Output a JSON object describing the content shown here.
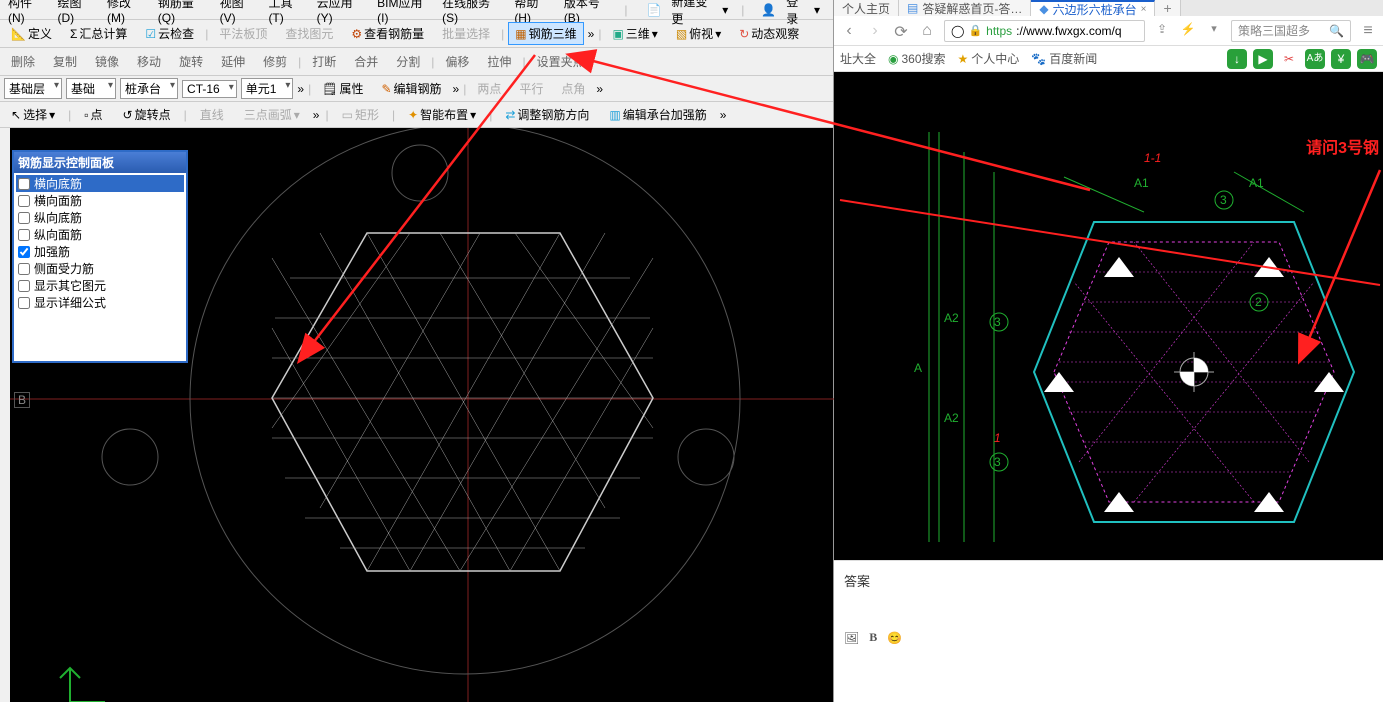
{
  "menubar": {
    "items": [
      "构件(N)",
      "绘图(D)",
      "修改(M)",
      "钢筋量(Q)",
      "视图(V)",
      "工具(T)",
      "云应用(Y)",
      "BIM应用(I)",
      "在线服务(S)",
      "帮助(H)",
      "版本号(B)"
    ],
    "new_change": "新建变更",
    "login": "登录"
  },
  "toolbar1": {
    "define": "定义",
    "sum_calc": "汇总计算",
    "cloud_check": "云检查",
    "flat_top": "平法板顶",
    "find_tu": "查找图元",
    "view_rebar_qty": "查看钢筋量",
    "batch_sel": "批量选择",
    "rebar_3d": "钢筋三维",
    "three_d": "三维",
    "top_view": "俯视",
    "dynamic_obs": "动态观察"
  },
  "toolbar2": {
    "del": "删除",
    "copy": "复制",
    "mirror": "镜像",
    "move": "移动",
    "rotate": "旋转",
    "extend": "延伸",
    "trim": "修剪",
    "break": "打断",
    "merge": "合并",
    "split": "分割",
    "offset": "偏移",
    "stretch": "拉伸",
    "set_base": "设置夹点"
  },
  "toolbar3": {
    "floor": "基础层",
    "category": "基础",
    "member": "桩承台",
    "code": "CT-16",
    "unit": "单元1",
    "attr": "属性",
    "edit_rebar": "编辑钢筋",
    "two_pt": "两点",
    "parallel": "平行",
    "point_angle": "点角"
  },
  "toolbar4": {
    "select": "选择",
    "point": "点",
    "rotate_pt": "旋转点",
    "line": "直线",
    "arc3": "三点画弧",
    "rect": "矩形",
    "smart": "智能布置",
    "adjust_dir": "调整钢筋方向",
    "edit_cap": "编辑承台加强筋"
  },
  "rebar_panel": {
    "title": "钢筋显示控制面板",
    "items": [
      {
        "label": "横向底筋",
        "checked": false,
        "selected": true
      },
      {
        "label": "横向面筋",
        "checked": false
      },
      {
        "label": "纵向底筋",
        "checked": false
      },
      {
        "label": "纵向面筋",
        "checked": false
      },
      {
        "label": "加强筋",
        "checked": true
      },
      {
        "label": "侧面受力筋",
        "checked": false
      },
      {
        "label": "显示其它图元",
        "checked": false
      },
      {
        "label": "显示详细公式",
        "checked": false
      }
    ]
  },
  "axis_b": "B",
  "browser": {
    "tabs": [
      {
        "label": "个人主页"
      },
      {
        "label": "答疑解惑首页-答…"
      },
      {
        "label": "六边形六桩承台",
        "active": true
      }
    ],
    "url_prefix": "https",
    "url_rest": "://www.fwxgx.com/q",
    "search_placeholder": "策略三国超多",
    "bookmarks": {
      "addr_all": "址大全",
      "search360": "360搜索",
      "personal": "个人中心",
      "baidu_news": "百度新闻"
    },
    "answer": "答案",
    "editor_b": "B"
  },
  "red_annot": "请问3号钢",
  "colors": {
    "red": "#ff2020",
    "green": "#20b030",
    "magenta": "#e040e0",
    "white": "#cccccc",
    "cyan": "#20c0c0"
  }
}
